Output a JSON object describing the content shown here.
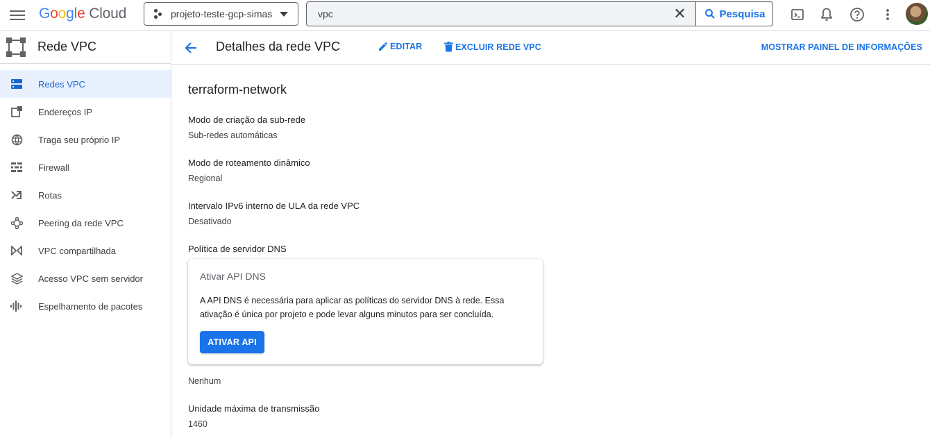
{
  "topbar": {
    "logo_letters": [
      "G",
      "o",
      "o",
      "g",
      "l",
      "e"
    ],
    "logo_cloud": "Cloud",
    "project_name": "projeto-teste-gcp-simas",
    "search_value": "vpc",
    "search_button": "Pesquisa",
    "icons": [
      "menu-icon",
      "cloud-shell-icon",
      "notifications-icon",
      "help-icon",
      "more-vert-icon"
    ]
  },
  "sidebar": {
    "title": "Rede VPC",
    "items": [
      {
        "label": "Redes VPC",
        "icon": "vpc-networks-icon",
        "active": true
      },
      {
        "label": "Endereços IP",
        "icon": "ip-addresses-icon",
        "active": false
      },
      {
        "label": "Traga seu próprio IP",
        "icon": "byoip-globe-icon",
        "active": false
      },
      {
        "label": "Firewall",
        "icon": "firewall-icon",
        "active": false
      },
      {
        "label": "Rotas",
        "icon": "routes-icon",
        "active": false
      },
      {
        "label": "Peering da rede VPC",
        "icon": "peering-icon",
        "active": false
      },
      {
        "label": "VPC compartilhada",
        "icon": "shared-vpc-icon",
        "active": false
      },
      {
        "label": "Acesso VPC sem servidor",
        "icon": "serverless-access-icon",
        "active": false
      },
      {
        "label": "Espelhamento de pacotes",
        "icon": "packet-mirroring-icon",
        "active": false
      }
    ]
  },
  "action_bar": {
    "title": "Detalhes da rede VPC",
    "edit": "EDITAR",
    "delete": "EXCLUIR REDE VPC",
    "show_info_panel": "MOSTRAR PAINEL DE INFORMAÇÕES"
  },
  "details": {
    "network_name": "terraform-network",
    "subnet_mode_label": "Modo de criação da sub-rede",
    "subnet_mode_value": "Sub-redes automáticas",
    "routing_mode_label": "Modo de roteamento dinâmico",
    "routing_mode_value": "Regional",
    "ipv6_label": "Intervalo IPv6 interno de ULA da rede VPC",
    "ipv6_value": "Desativado",
    "dns_policy_label": "Política de servidor DNS",
    "dns_card": {
      "title": "Ativar API DNS",
      "text": "A API DNS é necessária para aplicar as políticas do servidor DNS à rede. Essa ativação é única por projeto e pode levar alguns minutos para ser concluída.",
      "button": "ATIVAR API"
    },
    "dns_policy_value": "Nenhum",
    "mtu_label": "Unidade máxima de transmissão",
    "mtu_value": "1460"
  },
  "colors": {
    "accent": "#1a73e8",
    "active_bg": "#e8f0fe",
    "active_text": "#1967d2"
  }
}
